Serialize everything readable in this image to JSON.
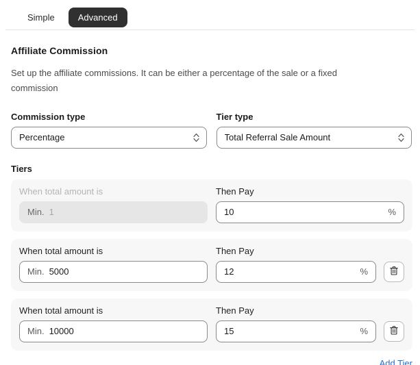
{
  "tabs": [
    {
      "label": "Simple",
      "active": false
    },
    {
      "label": "Advanced",
      "active": true
    }
  ],
  "section": {
    "title": "Affiliate Commission",
    "description": "Set up the affiliate commissions. It can be either a percentage of the sale or a fixed commission"
  },
  "fields": {
    "commission_type": {
      "label": "Commission type",
      "value": "Percentage"
    },
    "tier_type": {
      "label": "Tier type",
      "value": "Total Referral Sale Amount"
    }
  },
  "tiers": {
    "title": "Tiers",
    "when_label": "When total amount is",
    "then_label": "Then Pay",
    "min_prefix": "Min.",
    "percent_suffix": "%",
    "rows": [
      {
        "when_label": "When total amount is",
        "then_label": "Then Pay",
        "min_prefix": "Min.",
        "min_value": "1",
        "pay_value": "10",
        "percent_suffix": "%",
        "disabled": true,
        "deletable": false
      },
      {
        "when_label": "When total amount is",
        "then_label": "Then Pay",
        "min_prefix": "Min.",
        "min_value": "5000",
        "pay_value": "12",
        "percent_suffix": "%",
        "disabled": false,
        "deletable": true
      },
      {
        "when_label": "When total amount is",
        "then_label": "Then Pay",
        "min_prefix": "Min.",
        "min_value": "10000",
        "pay_value": "15",
        "percent_suffix": "%",
        "disabled": false,
        "deletable": true
      }
    ],
    "add_tier_label": "Add Tier"
  },
  "icons": {
    "chevron_updown": "chevron-updown-icon",
    "trash": "trash-icon"
  },
  "colors": {
    "tab_active_bg": "#303030",
    "link": "#2c6ecb",
    "card_bg": "#f7f7f7",
    "disabled_input_bg": "#e6e6e6"
  }
}
